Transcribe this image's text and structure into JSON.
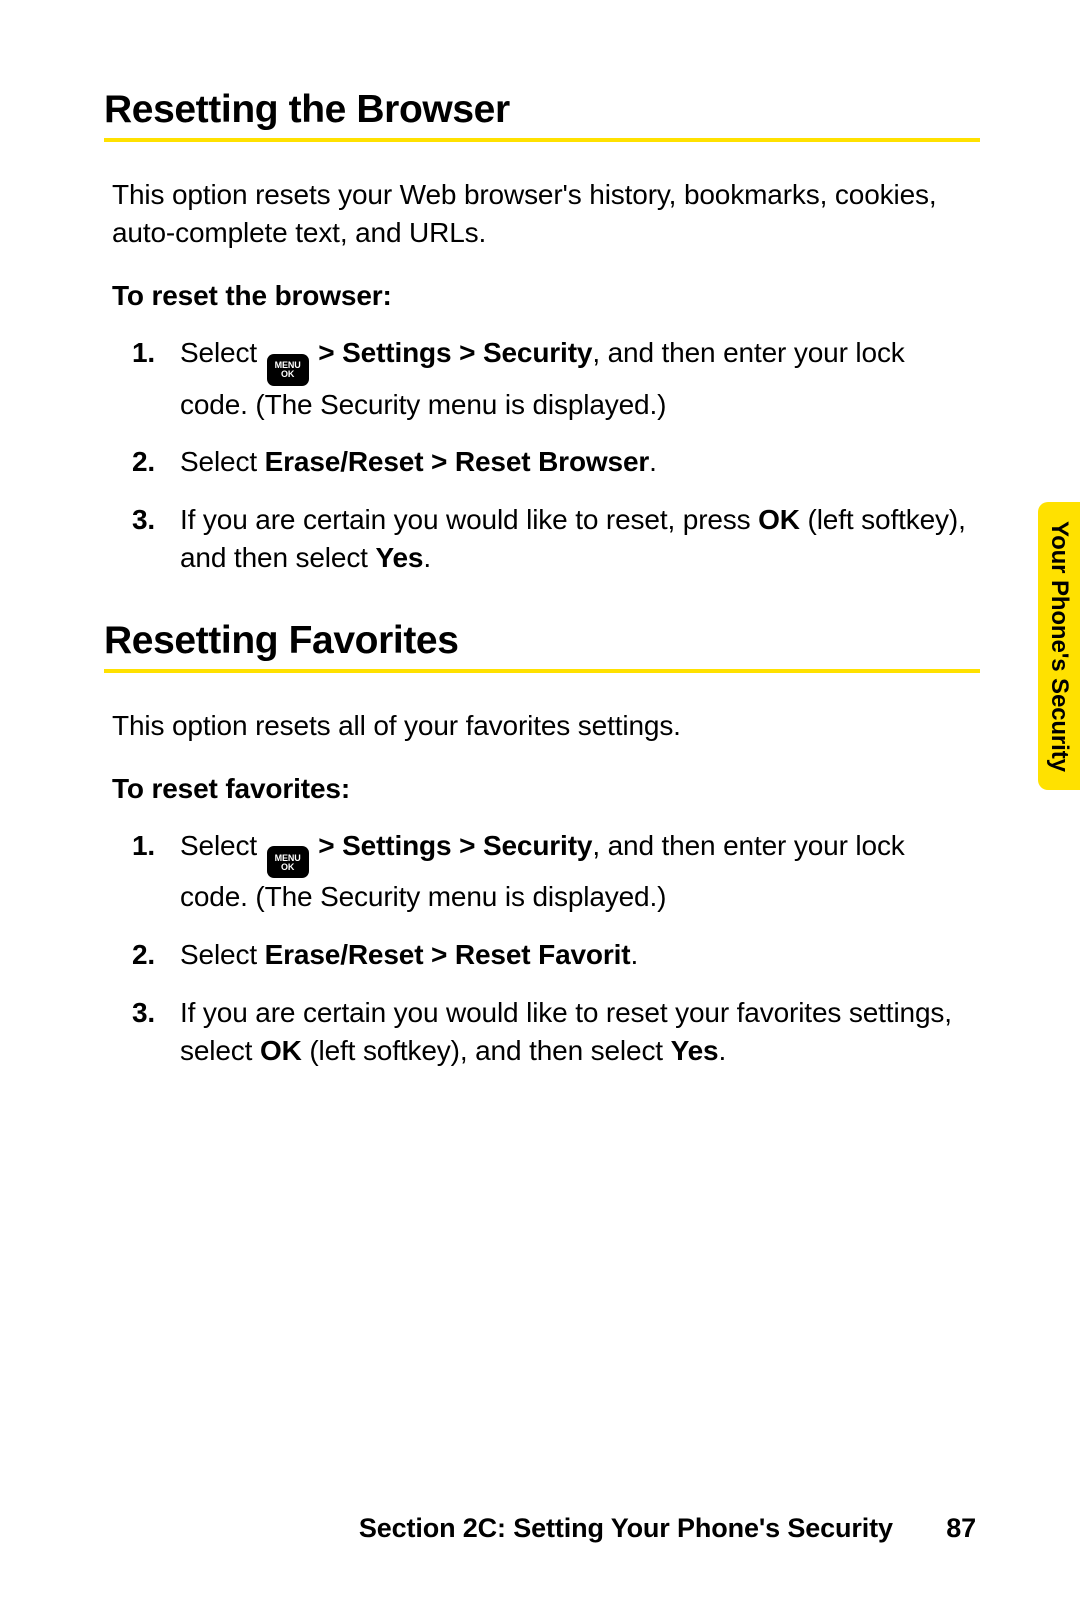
{
  "sidebar": {
    "label": "Your Phone's Security"
  },
  "menuIcon": {
    "line1": "MENU",
    "line2": "OK"
  },
  "sections": [
    {
      "heading": "Resetting the Browser",
      "intro": "This option resets your Web browser's history, bookmarks, cookies, auto-complete text, and URLs.",
      "subhead": "To reset the browser:",
      "steps": [
        {
          "num": "1.",
          "pre": "Select ",
          "boldA": " > Settings > Security",
          "mid": ", and then enter your lock code. (The Security menu is displayed.)"
        },
        {
          "num": "2.",
          "pre": "Select ",
          "boldA": "Erase/Reset > Reset Browser",
          "mid": "."
        },
        {
          "num": "3.",
          "pre": "If you are certain you would like to reset, press ",
          "boldA": "OK",
          "mid": " (left softkey), and then select ",
          "boldB": "Yes",
          "post": "."
        }
      ]
    },
    {
      "heading": "Resetting Favorites",
      "intro": "This option resets all of your favorites settings.",
      "subhead": "To reset favorites:",
      "steps": [
        {
          "num": "1.",
          "pre": "Select ",
          "boldA": " > Settings > Security",
          "mid": ", and then enter your lock code. (The Security menu is displayed.)"
        },
        {
          "num": "2.",
          "pre": "Select ",
          "boldA": "Erase/Reset > Reset Favorit",
          "mid": "."
        },
        {
          "num": "3.",
          "pre": " If you are certain you would like to reset your favorites settings, select ",
          "boldA": "OK",
          "mid": " (left softkey), and then select ",
          "boldB": "Yes",
          "post": "."
        }
      ]
    }
  ],
  "footer": {
    "label": "Section 2C: Setting Your Phone's Security",
    "page": "87"
  }
}
